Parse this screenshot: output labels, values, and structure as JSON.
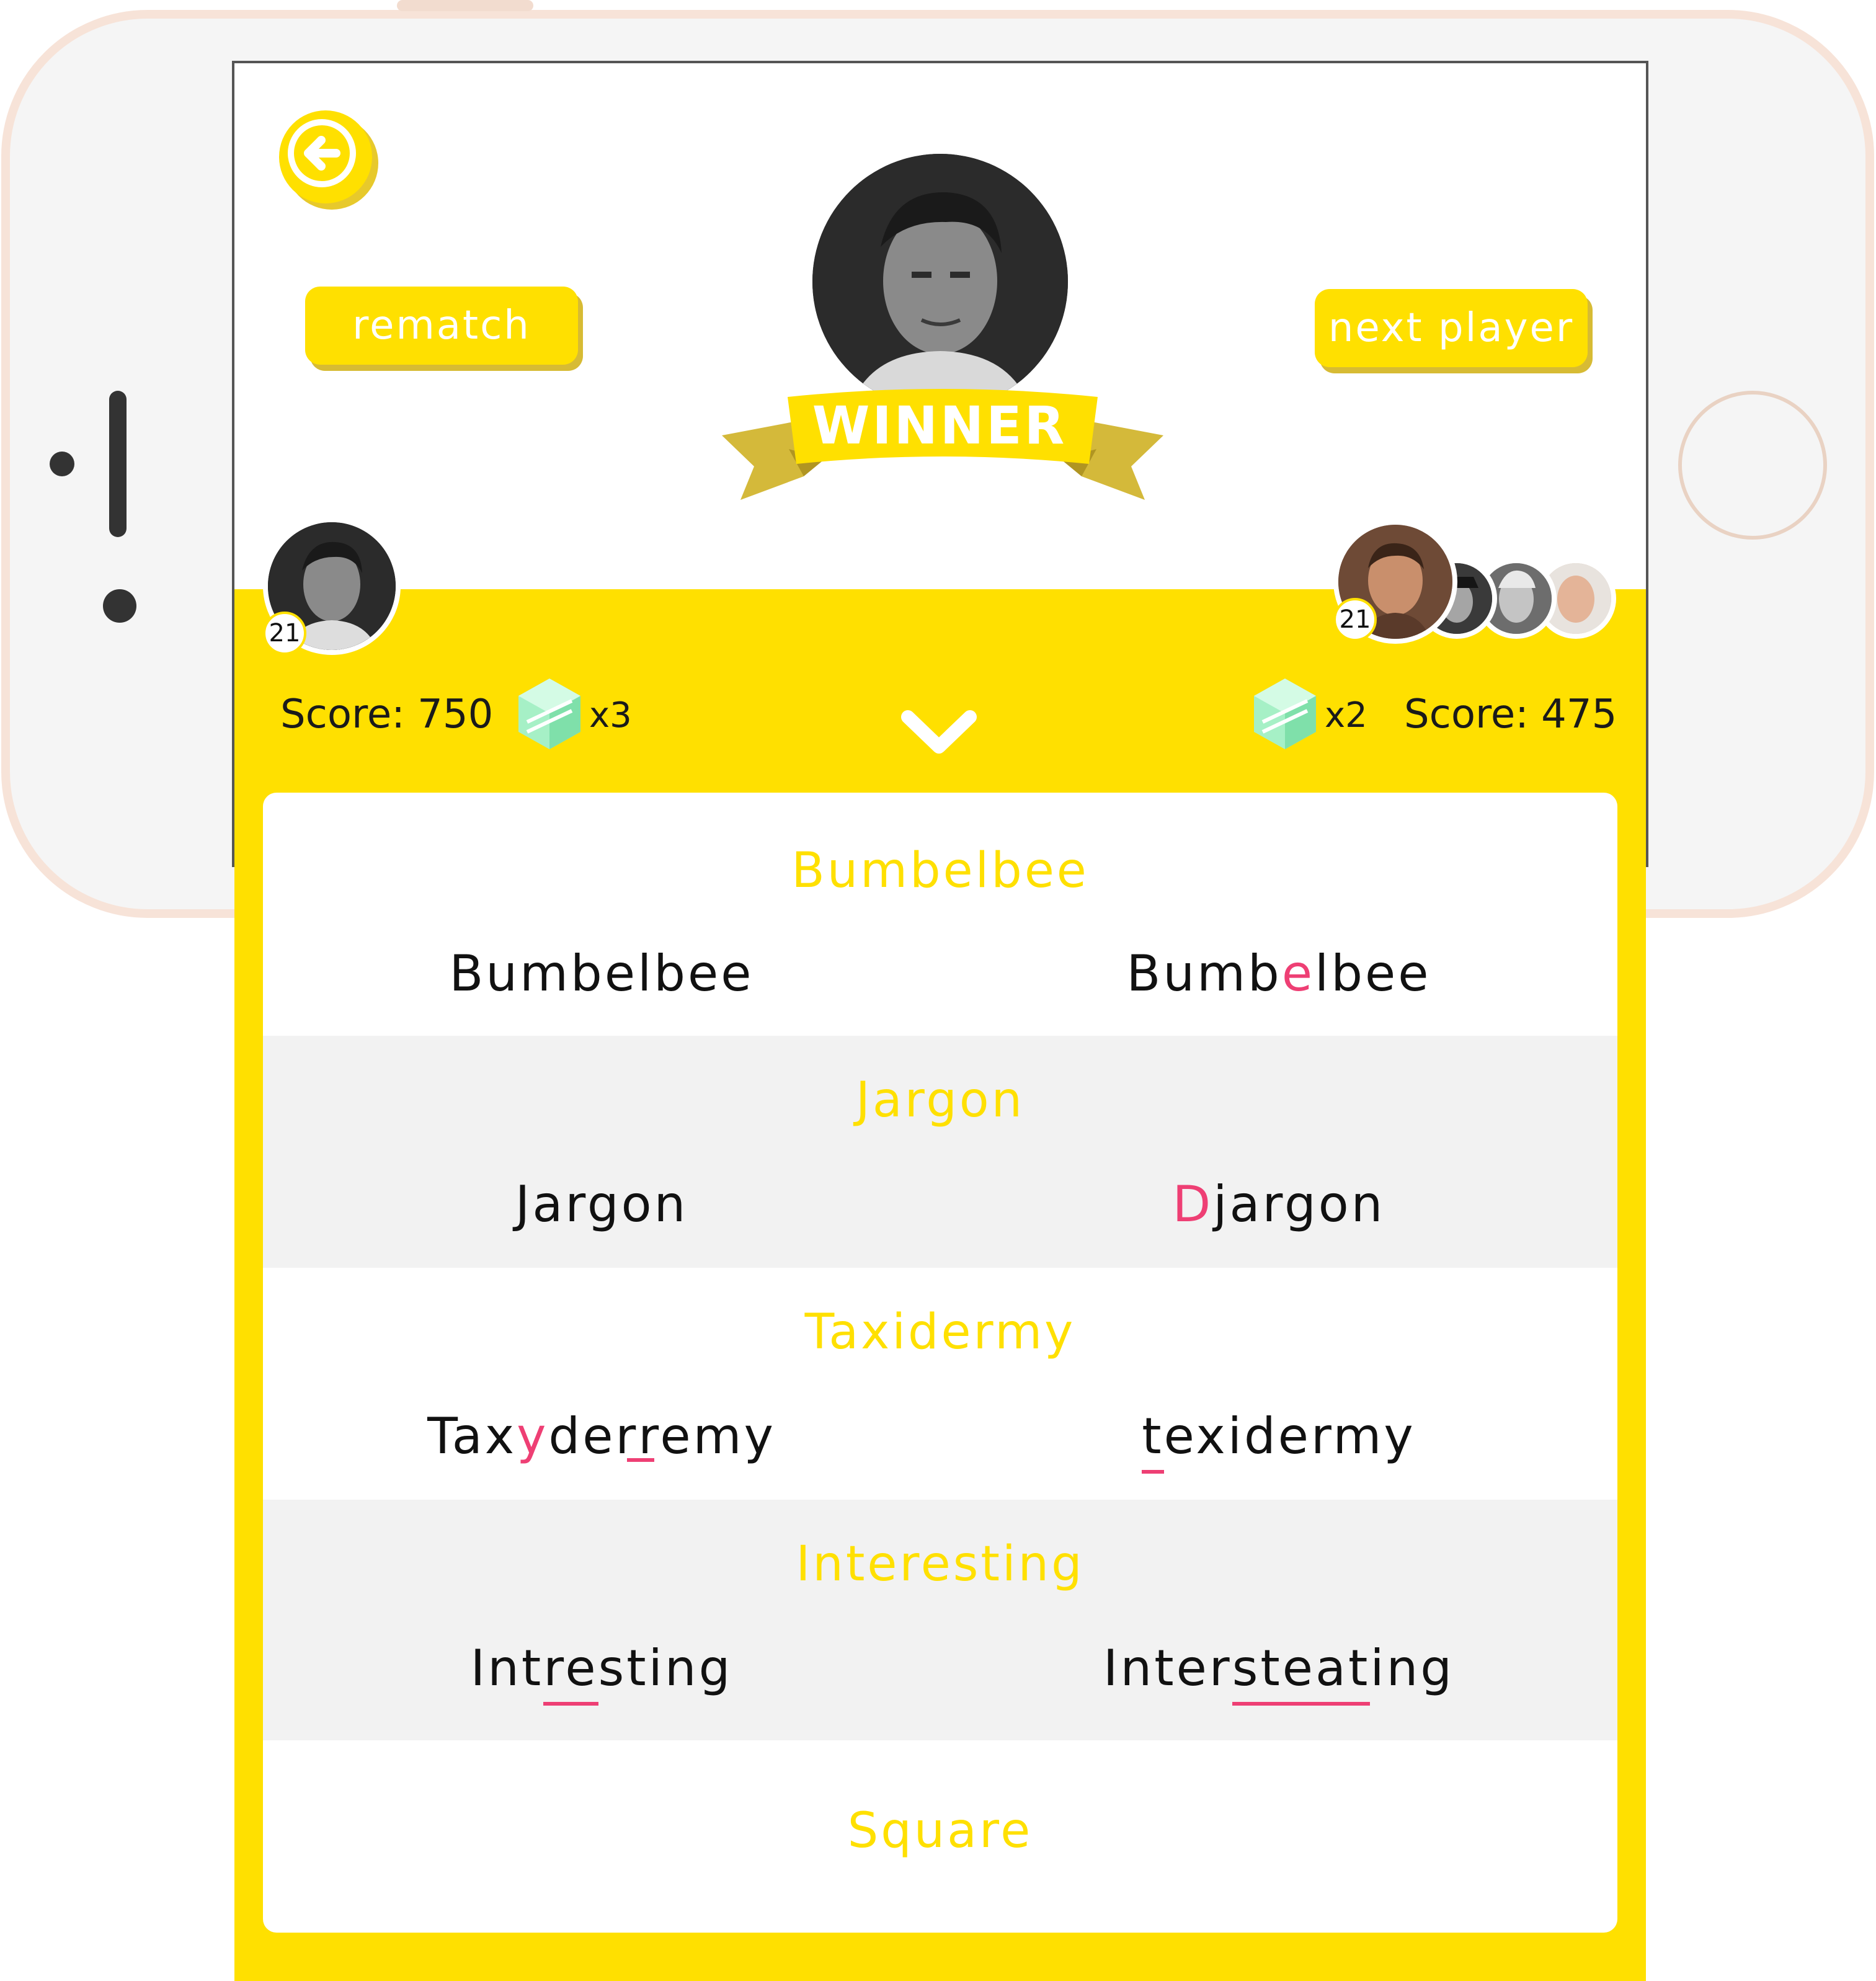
{
  "colors": {
    "accent": "#ffe000",
    "error": "#ee3f74",
    "ribbon_shadow": "#d4b93a"
  },
  "header": {
    "back_icon": "arrow-left-icon",
    "rematch_label": "rematch",
    "next_player_label": "next player",
    "winner_label": "WINNER"
  },
  "player1": {
    "level": "21",
    "score_text": "Score: 750",
    "gems_text": "x3"
  },
  "player2": {
    "level": "21",
    "score_text": "Score: 475",
    "gems_text": "x2"
  },
  "words": [
    {
      "target": "Bumbelbee",
      "p1": "Bumbelbee",
      "p2": "Bumbelbee"
    },
    {
      "target": "Jargon",
      "p1": "Jargon",
      "p2": "Djargon"
    },
    {
      "target": "Taxidermy",
      "p1": "Taxyderremy",
      "p2": "texidermy"
    },
    {
      "target": "Interesting",
      "p1": "Intresting",
      "p2": "Intersteating"
    },
    {
      "target": "Square"
    }
  ]
}
